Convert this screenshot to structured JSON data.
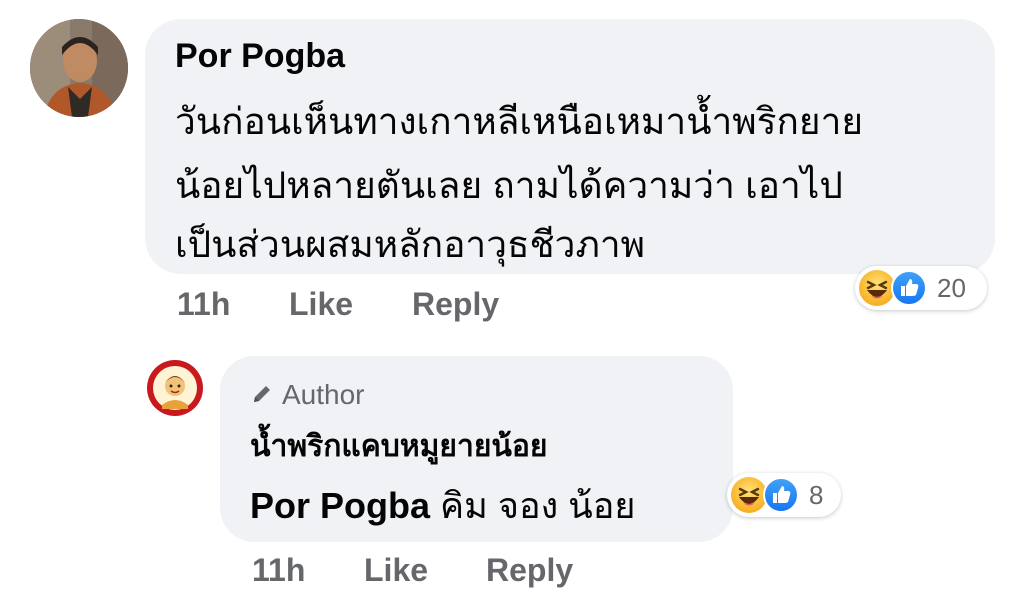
{
  "comment": {
    "author": "Por Pogba",
    "lines": [
      "วันก่อนเห็นทางเกาหลีเหนือเหมาน้ำพริกยาย",
      "น้อยไปหลายตันเลย ถามได้ความว่า เอาไป",
      "เป็นส่วนผสมหลักอาวุธชีวภาพ"
    ],
    "time": "11h",
    "like_label": "Like",
    "reply_label": "Reply",
    "reaction_count": "20",
    "reaction_icons": [
      "haha-icon",
      "like-icon"
    ]
  },
  "reply": {
    "badge": "Author",
    "page_name": "น้ำพริกแคบหมูยายน้อย",
    "mention": "Por Pogba",
    "text": " คิม จอง น้อย",
    "time": "11h",
    "like_label": "Like",
    "reply_label": "Reply",
    "reaction_count": "8",
    "reaction_icons": [
      "haha-icon",
      "like-icon"
    ]
  },
  "colors": {
    "bubble": "#f0f2f5",
    "text": "#050505",
    "muted": "#65676b",
    "like_blue": "#1877f2",
    "haha_yellow": "#f7b125"
  }
}
